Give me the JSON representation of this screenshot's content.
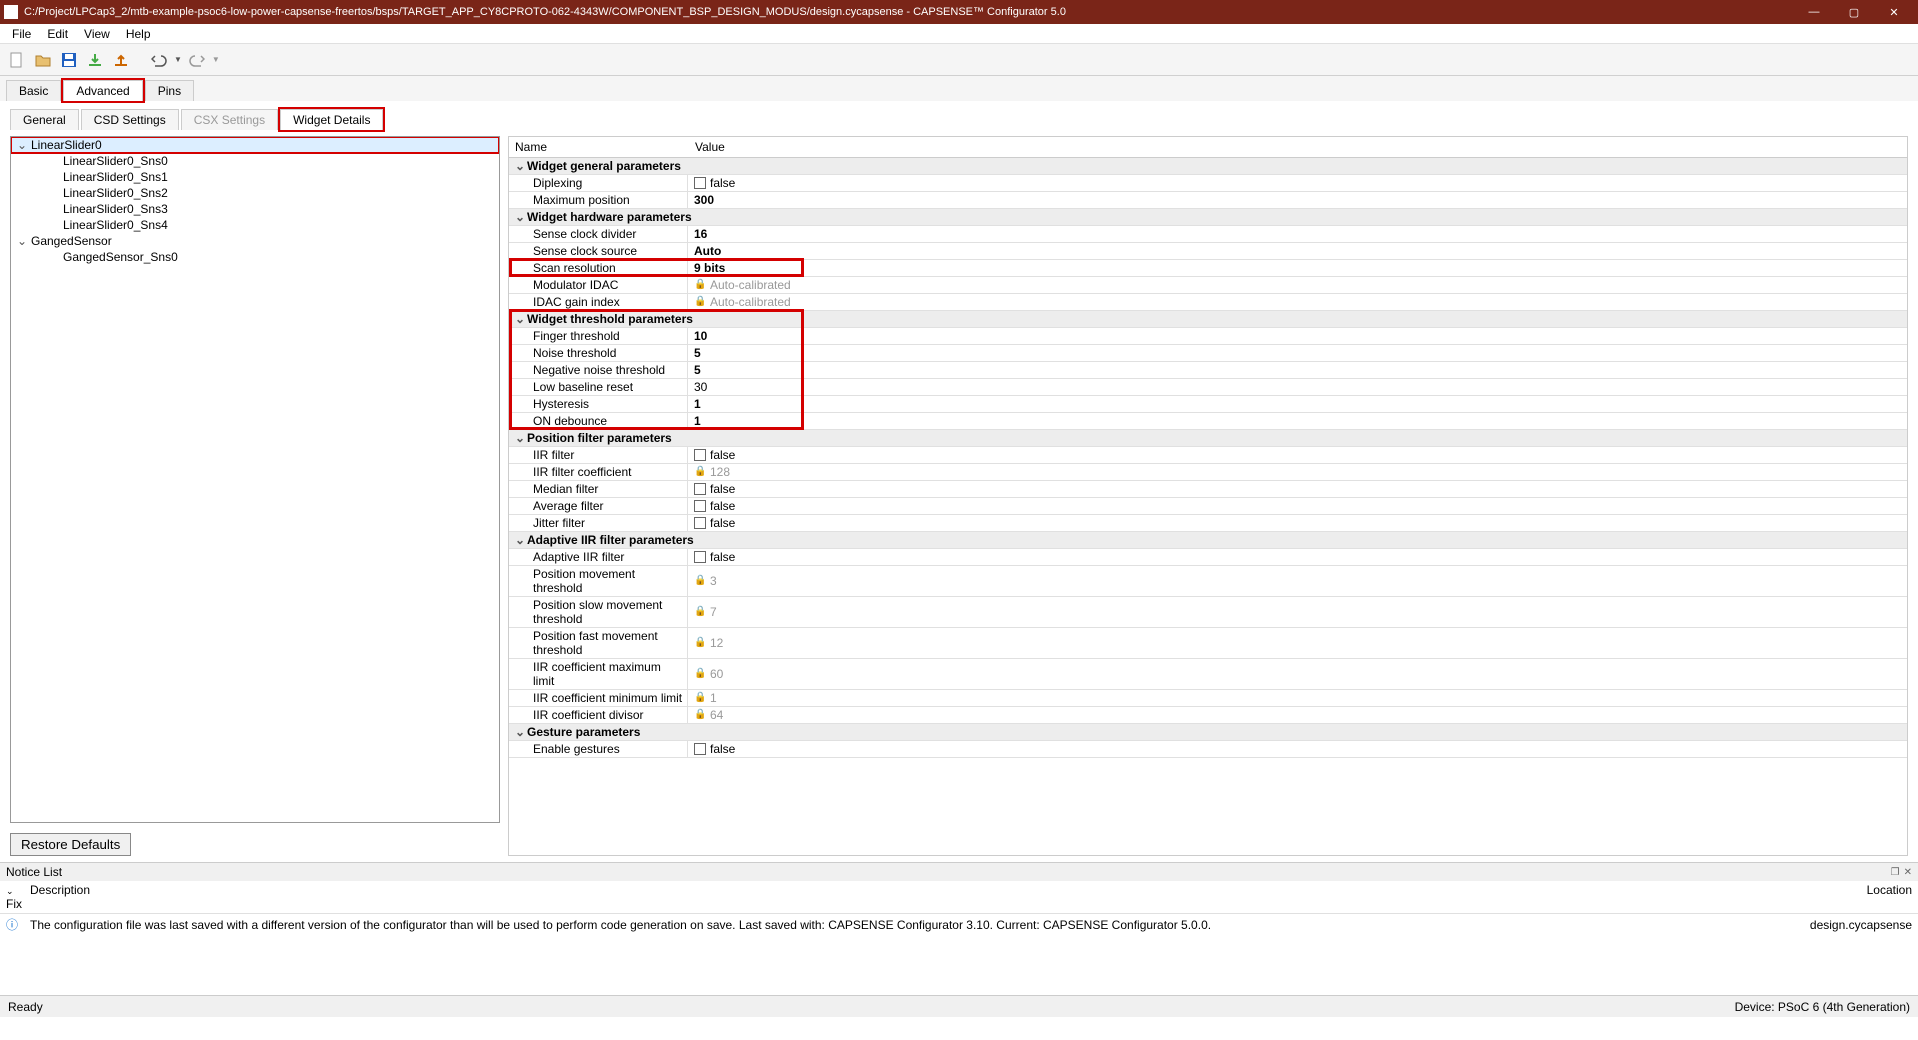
{
  "titlebar": {
    "title": "C:/Project/LPCap3_2/mtb-example-psoc6-low-power-capsense-freertos/bsps/TARGET_APP_CY8CPROTO-062-4343W/COMPONENT_BSP_DESIGN_MODUS/design.cycapsense - CAPSENSE™ Configurator 5.0"
  },
  "menubar": [
    "File",
    "Edit",
    "View",
    "Help"
  ],
  "main_tabs": [
    {
      "label": "Basic",
      "active": false,
      "hl": false
    },
    {
      "label": "Advanced",
      "active": true,
      "hl": true
    },
    {
      "label": "Pins",
      "active": false,
      "hl": false
    }
  ],
  "sub_tabs": [
    {
      "label": "General",
      "active": false,
      "disabled": false,
      "hl": false
    },
    {
      "label": "CSD Settings",
      "active": false,
      "disabled": false,
      "hl": false
    },
    {
      "label": "CSX Settings",
      "active": false,
      "disabled": true,
      "hl": false
    },
    {
      "label": "Widget Details",
      "active": true,
      "disabled": false,
      "hl": true
    }
  ],
  "tree": [
    {
      "label": "LinearSlider0",
      "indent": 0,
      "chev": "⌄",
      "sel": true,
      "hl": true
    },
    {
      "label": "LinearSlider0_Sns0",
      "indent": 2,
      "chev": "",
      "sel": false
    },
    {
      "label": "LinearSlider0_Sns1",
      "indent": 2,
      "chev": "",
      "sel": false
    },
    {
      "label": "LinearSlider0_Sns2",
      "indent": 2,
      "chev": "",
      "sel": false
    },
    {
      "label": "LinearSlider0_Sns3",
      "indent": 2,
      "chev": "",
      "sel": false
    },
    {
      "label": "LinearSlider0_Sns4",
      "indent": 2,
      "chev": "",
      "sel": false
    },
    {
      "label": "GangedSensor",
      "indent": 0,
      "chev": "⌄",
      "sel": false
    },
    {
      "label": "GangedSensor_Sns0",
      "indent": 2,
      "chev": "",
      "sel": false
    }
  ],
  "restore_label": "Restore Defaults",
  "grid_head": {
    "name": "Name",
    "value": "Value"
  },
  "params": [
    {
      "type": "group",
      "label": "Widget general parameters"
    },
    {
      "type": "prop",
      "name": "Diplexing",
      "vtype": "check",
      "value": "false"
    },
    {
      "type": "prop",
      "name": "Maximum position",
      "vtype": "bold",
      "value": "300"
    },
    {
      "type": "group",
      "label": "Widget hardware parameters"
    },
    {
      "type": "prop",
      "name": "Sense clock divider",
      "vtype": "bold",
      "value": "16"
    },
    {
      "type": "prop",
      "name": "Sense clock source",
      "vtype": "bold",
      "value": "Auto"
    },
    {
      "type": "prop",
      "name": "Scan resolution",
      "vtype": "bold",
      "value": "9 bits",
      "hl": "scan"
    },
    {
      "type": "prop",
      "name": "Modulator IDAC",
      "vtype": "lock",
      "value": "Auto-calibrated"
    },
    {
      "type": "prop",
      "name": "IDAC gain index",
      "vtype": "lock",
      "value": "Auto-calibrated"
    },
    {
      "type": "group",
      "label": "Widget threshold parameters",
      "hl": "thr-start"
    },
    {
      "type": "prop",
      "name": "Finger threshold",
      "vtype": "bold",
      "value": "10"
    },
    {
      "type": "prop",
      "name": "Noise threshold",
      "vtype": "bold",
      "value": "5"
    },
    {
      "type": "prop",
      "name": "Negative noise threshold",
      "vtype": "bold",
      "value": "5"
    },
    {
      "type": "prop",
      "name": "Low baseline reset",
      "vtype": "plain",
      "value": "30"
    },
    {
      "type": "prop",
      "name": "Hysteresis",
      "vtype": "bold",
      "value": "1"
    },
    {
      "type": "prop",
      "name": "ON debounce",
      "vtype": "bold",
      "value": "1",
      "hl": "thr-end"
    },
    {
      "type": "group",
      "label": "Position filter parameters"
    },
    {
      "type": "prop",
      "name": "IIR filter",
      "vtype": "check",
      "value": "false"
    },
    {
      "type": "prop",
      "name": "IIR filter coefficient",
      "vtype": "lock",
      "value": "128"
    },
    {
      "type": "prop",
      "name": "Median filter",
      "vtype": "check",
      "value": "false"
    },
    {
      "type": "prop",
      "name": "Average filter",
      "vtype": "check",
      "value": "false"
    },
    {
      "type": "prop",
      "name": "Jitter filter",
      "vtype": "check",
      "value": "false"
    },
    {
      "type": "group",
      "label": "Adaptive IIR filter parameters"
    },
    {
      "type": "prop",
      "name": "Adaptive IIR filter",
      "vtype": "check",
      "value": "false"
    },
    {
      "type": "prop",
      "name": "Position movement threshold",
      "vtype": "lock",
      "value": "3"
    },
    {
      "type": "prop",
      "name": "Position slow movement threshold",
      "vtype": "lock",
      "value": "7"
    },
    {
      "type": "prop",
      "name": "Position fast movement threshold",
      "vtype": "lock",
      "value": "12"
    },
    {
      "type": "prop",
      "name": "IIR coefficient maximum limit",
      "vtype": "lock",
      "value": "60"
    },
    {
      "type": "prop",
      "name": "IIR coefficient minimum limit",
      "vtype": "lock",
      "value": "1"
    },
    {
      "type": "prop",
      "name": "IIR coefficient divisor",
      "vtype": "lock",
      "value": "64"
    },
    {
      "type": "group",
      "label": "Gesture parameters"
    },
    {
      "type": "prop",
      "name": "Enable gestures",
      "vtype": "check",
      "value": "false"
    }
  ],
  "notice": {
    "title": "Notice List",
    "cols": {
      "fix": "Fix",
      "desc": "Description",
      "loc": "Location"
    },
    "row": {
      "desc": "The configuration file was last saved with a different version of the configurator than will be used to perform code generation on save. Last saved with: CAPSENSE Configurator 3.10. Current: CAPSENSE Configurator 5.0.0.",
      "loc": "design.cycapsense"
    }
  },
  "status": {
    "left": "Ready",
    "right": "Device: PSoC 6 (4th Generation)"
  }
}
